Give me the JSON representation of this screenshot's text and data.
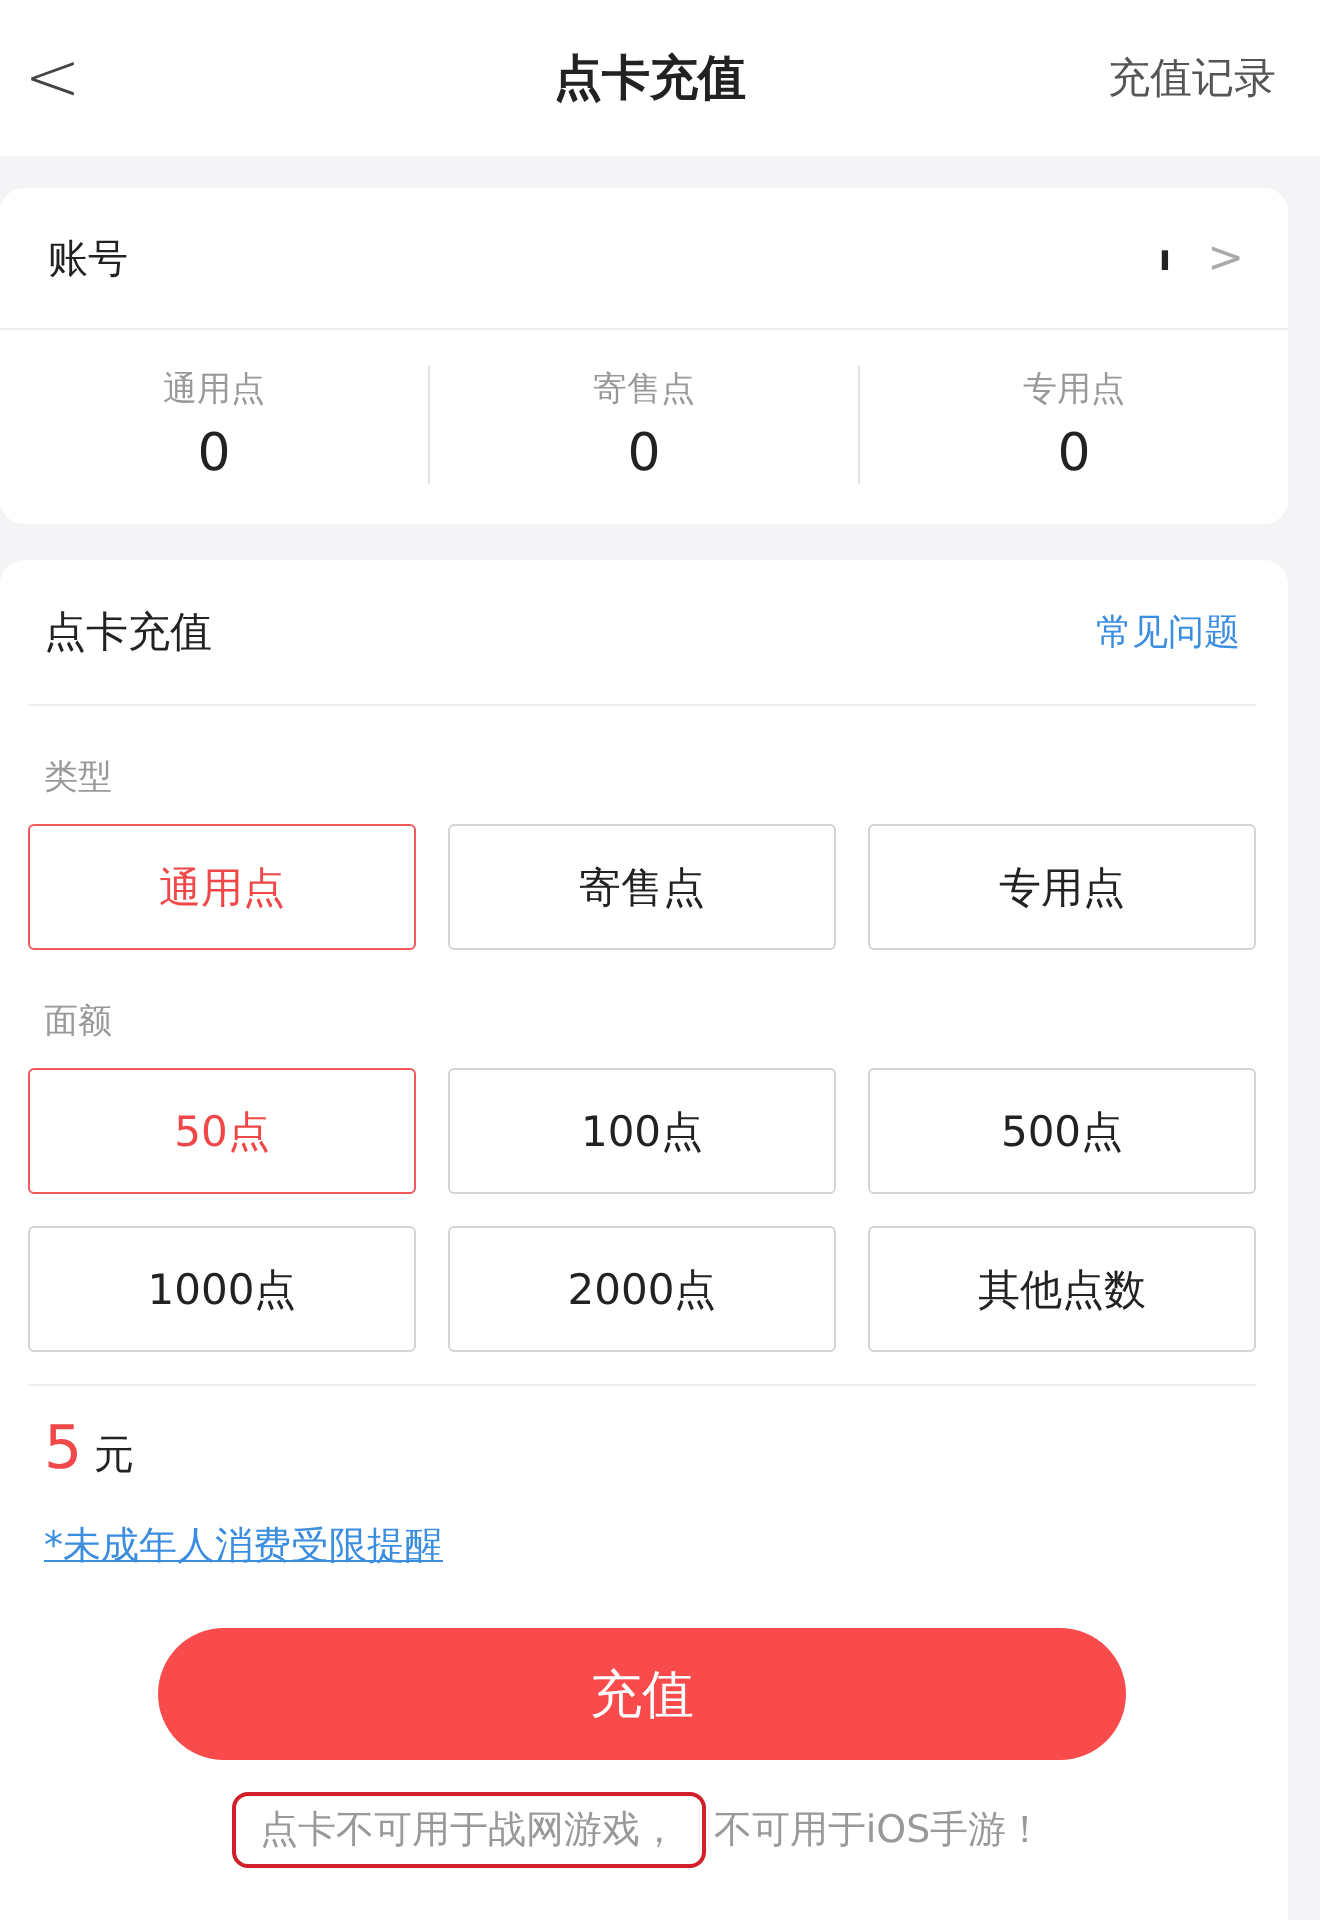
{
  "header": {
    "back": "<",
    "title": "点卡充值",
    "action": "充值记录"
  },
  "account": {
    "label": "账号",
    "value": "ı",
    "chevron": ">"
  },
  "balances": [
    {
      "label": "通用点",
      "value": "0"
    },
    {
      "label": "寄售点",
      "value": "0"
    },
    {
      "label": "专用点",
      "value": "0"
    }
  ],
  "recharge": {
    "title": "点卡充值",
    "faq": "常见问题",
    "type_label": "类型",
    "types": [
      {
        "label": "通用点",
        "selected": true
      },
      {
        "label": "寄售点",
        "selected": false
      },
      {
        "label": "专用点",
        "selected": false
      }
    ],
    "amount_label": "面额",
    "amounts": [
      {
        "label": "50点",
        "selected": true
      },
      {
        "label": "100点",
        "selected": false
      },
      {
        "label": "500点",
        "selected": false
      },
      {
        "label": "1000点",
        "selected": false
      },
      {
        "label": "2000点",
        "selected": false
      },
      {
        "label": "其他点数",
        "selected": false
      }
    ],
    "price": "5",
    "currency": "元",
    "minor_link": "*未成年人消费受限提醒",
    "submit": "充值",
    "notice": [
      {
        "text": "点卡不可用于战网游戏，",
        "highlighted": true
      },
      {
        "text": "不可用于iOS手游！",
        "highlighted": false
      }
    ]
  }
}
